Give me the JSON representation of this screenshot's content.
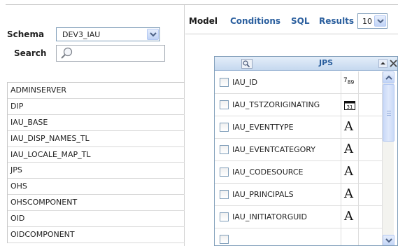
{
  "schema": {
    "label": "Schema",
    "value": "DEV3_IAU"
  },
  "search": {
    "label": "Search",
    "value": ""
  },
  "table_list": [
    "ADMINSERVER",
    "DIP",
    "IAU_BASE",
    "IAU_DISP_NAMES_TL",
    "IAU_LOCALE_MAP_TL",
    "JPS",
    "OHS",
    "OHSCOMPONENT",
    "OID",
    "OIDCOMPONENT"
  ],
  "tabs": [
    {
      "label": "Model",
      "active": true
    },
    {
      "label": "Conditions",
      "active": false
    },
    {
      "label": "SQL",
      "active": false
    },
    {
      "label": "Results",
      "active": false
    }
  ],
  "results_count": "10",
  "jps_panel": {
    "title": "JPS",
    "columns": [
      {
        "name": "IAU_ID",
        "type_icon": "number-icon",
        "type_glyph": "789"
      },
      {
        "name": "IAU_TSTZORIGINATING",
        "type_icon": "calendar-icon",
        "type_glyph": "31"
      },
      {
        "name": "IAU_EVENTTYPE",
        "type_icon": "text-type-icon",
        "type_glyph": "A"
      },
      {
        "name": "IAU_EVENTCATEGORY",
        "type_icon": "text-type-icon",
        "type_glyph": "A"
      },
      {
        "name": "IAU_CODESOURCE",
        "type_icon": "text-type-icon",
        "type_glyph": "A"
      },
      {
        "name": "IAU_PRINCIPALS",
        "type_icon": "text-type-icon",
        "type_glyph": "A"
      },
      {
        "name": "IAU_INITIATORGUID",
        "type_icon": "text-type-icon",
        "type_glyph": "A"
      }
    ]
  },
  "colors": {
    "link": "#2b5f9e",
    "header_start": "#e4eef9",
    "header_end": "#c5d8ef",
    "border": "#7f9db9"
  }
}
